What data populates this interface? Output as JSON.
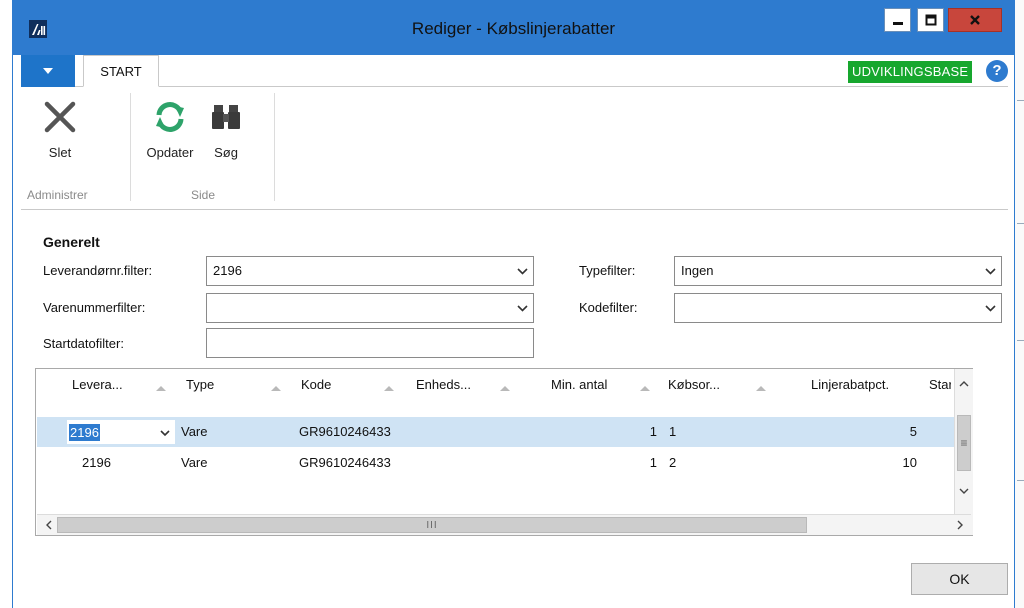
{
  "window": {
    "title": "Rediger - Købslinjerabatter"
  },
  "ribbon": {
    "tab": "START",
    "environment_badge": "UDVIKLINGSBASE",
    "help_symbol": "?",
    "buttons": {
      "delete": "Slet",
      "refresh": "Opdater",
      "find": "Søg"
    },
    "groups": {
      "manage": "Administrer",
      "page": "Side"
    }
  },
  "general": {
    "title": "Generelt",
    "vendor_filter": {
      "label": "Leverandørnr.filter:",
      "value": "2196"
    },
    "item_filter": {
      "label": "Varenummerfilter:",
      "value": ""
    },
    "start_date_filter": {
      "label": "Startdatofilter:",
      "value": ""
    },
    "type_filter": {
      "label": "Typefilter:",
      "value": "Ingen"
    },
    "code_filter": {
      "label": "Kodefilter:",
      "value": ""
    }
  },
  "grid": {
    "columns": [
      "Levera...",
      "Type",
      "Kode",
      "Enheds...",
      "Min. antal",
      "Købsor...",
      "Linjerabatpct.",
      "Startda"
    ],
    "rows": [
      {
        "vendor": "2196",
        "type": "Vare",
        "code": "GR9610246433",
        "unit": "",
        "min_qty": "1",
        "purchase_order": "1",
        "discount_pct": "5",
        "start_date": ""
      },
      {
        "vendor": "2196",
        "type": "Vare",
        "code": "GR9610246433",
        "unit": "",
        "min_qty": "1",
        "purchase_order": "2",
        "discount_pct": "10",
        "start_date": ""
      }
    ],
    "scroll_thumb_glyph": "III",
    "vscroll_thumb_glyph": "≡"
  },
  "footer": {
    "ok_label": "OK"
  },
  "colors": {
    "titlebar": "#2e7bcf",
    "badge": "#17a72e",
    "selection": "#cfe3f4",
    "close": "#c8463c"
  }
}
